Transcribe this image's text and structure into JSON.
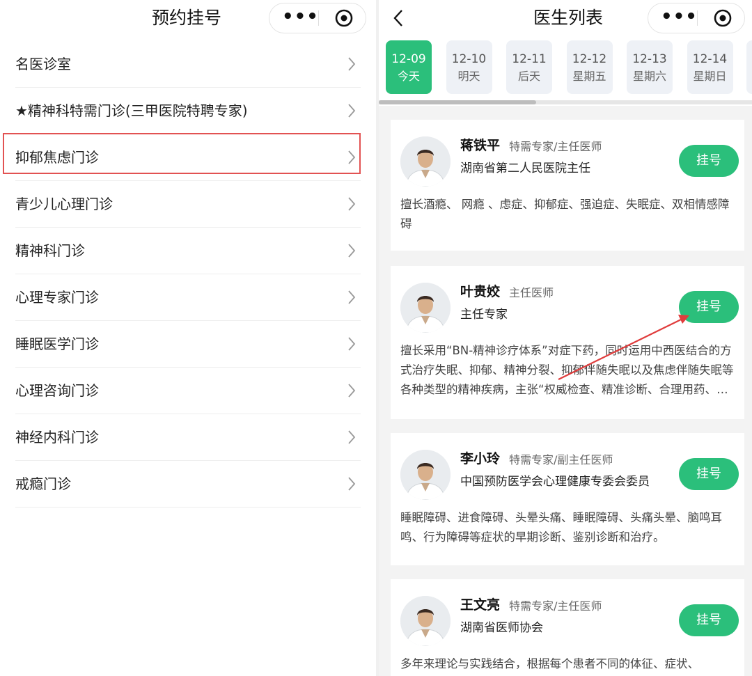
{
  "left": {
    "title": "预约挂号",
    "departments": [
      {
        "label": "名医诊室"
      },
      {
        "label": "★精神科特需门诊(三甲医院特聘专家)"
      },
      {
        "label": "抑郁焦虑门诊"
      },
      {
        "label": "青少儿心理门诊"
      },
      {
        "label": "精神科门诊"
      },
      {
        "label": "心理专家门诊"
      },
      {
        "label": "睡眠医学门诊"
      },
      {
        "label": "心理咨询门诊"
      },
      {
        "label": "神经内科门诊"
      },
      {
        "label": "戒瘾门诊"
      }
    ],
    "highlighted_index": 2
  },
  "right": {
    "title": "医生列表",
    "dates": [
      {
        "date": "12-09",
        "weekday": "今天",
        "active": true
      },
      {
        "date": "12-10",
        "weekday": "明天"
      },
      {
        "date": "12-11",
        "weekday": "后天"
      },
      {
        "date": "12-12",
        "weekday": "星期五"
      },
      {
        "date": "12-13",
        "weekday": "星期六"
      },
      {
        "date": "12-14",
        "weekday": "星期日"
      }
    ],
    "register_label": "挂号",
    "doctors": [
      {
        "name": "蒋铁平",
        "title": "特需专家/主任医师",
        "org": "湖南省第二人民医院主任",
        "desc": "擅长酒瘾、 网瘾 、虑症、抑郁症、强迫症、失眠症、双相情感障碍"
      },
      {
        "name": "叶贵姣",
        "title": "主任医师",
        "org": "主任专家",
        "desc": "擅长采用“BN-精神诊疗体系”对症下药，同时运用中西医结合的方式治疗失眠、抑郁、精神分裂、抑郁伴随失眠以及焦虑伴随失眠等各种类型的精神疾病，主张“权威检查、精准诊断、合理用药、综合疗法”"
      },
      {
        "name": "李小玲",
        "title": "特需专家/副主任医师",
        "org": "中国预防医学会心理健康专委会委员",
        "desc": "睡眠障碍、进食障碍、头晕头痛、睡眠障碍、头痛头晕、脑鸣耳鸣、行为障碍等症状的早期诊断、鉴别诊断和治疗。"
      },
      {
        "name": "王文亮",
        "title": "特需专家/主任医师",
        "org": "湖南省医师协会",
        "desc": "多年来理论与实践结合，根据每个患者不同的体征、症状、"
      }
    ]
  },
  "capsule": {
    "more_icon": "more-dots-icon",
    "close_icon": "target-circle-icon"
  },
  "colors": {
    "accent": "#2bbf7b",
    "highlight": "#e25252",
    "annotation_arrow": "#e03c3c"
  }
}
